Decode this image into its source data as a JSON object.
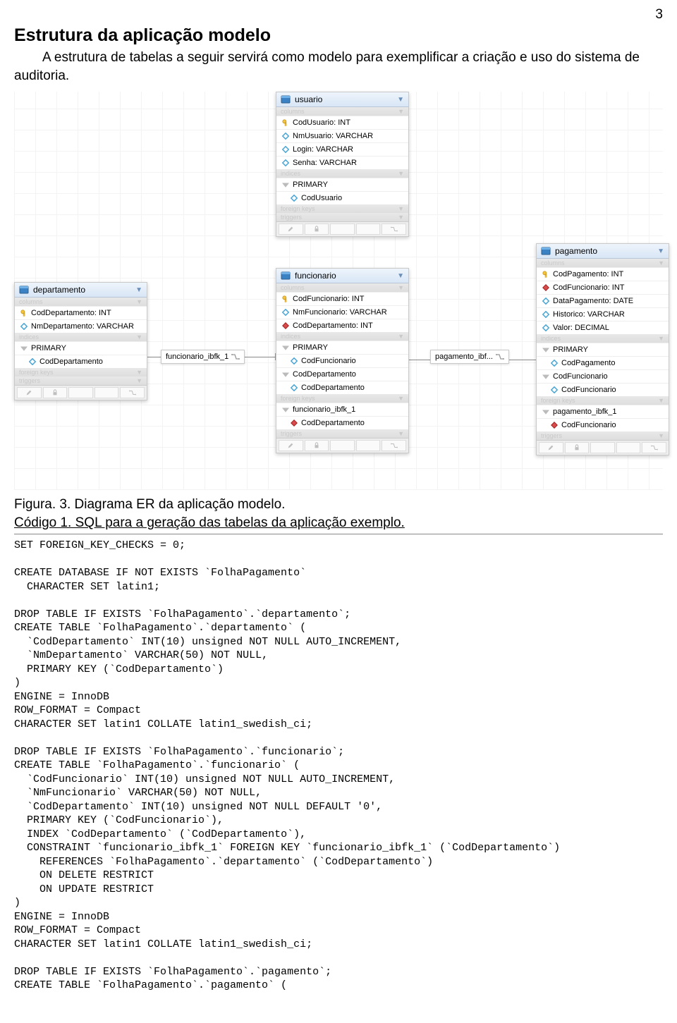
{
  "page_number": "3",
  "heading": "Estrutura da aplicação modelo",
  "intro": "A estrutura de tabelas a seguir servirá como modelo para exemplificar a criação e uso do sistema de auditoria.",
  "caption": "Figura. 3. Diagrama ER da aplicação modelo.",
  "code_title": "Código 1. SQL para a geração das tabelas da aplicação exemplo.",
  "diagram": {
    "tables": {
      "usuario": {
        "title": "usuario",
        "columns": [
          {
            "icon": "key",
            "text": "CodUsuario: INT"
          },
          {
            "icon": "dia",
            "text": "NmUsuario: VARCHAR"
          },
          {
            "icon": "dia",
            "text": "Login: VARCHAR"
          },
          {
            "icon": "dia",
            "text": "Senha: VARCHAR"
          }
        ],
        "indices": [
          {
            "text": "PRIMARY",
            "children": [
              {
                "icon": "dia",
                "text": "CodUsuario"
              }
            ]
          }
        ],
        "fk": [],
        "triggers": []
      },
      "departamento": {
        "title": "departamento",
        "columns": [
          {
            "icon": "key",
            "text": "CodDepartamento: INT"
          },
          {
            "icon": "dia",
            "text": "NmDepartamento: VARCHAR"
          }
        ],
        "indices": [
          {
            "text": "PRIMARY",
            "children": [
              {
                "icon": "dia",
                "text": "CodDepartamento"
              }
            ]
          }
        ],
        "fk": [],
        "triggers": []
      },
      "funcionario": {
        "title": "funcionario",
        "columns": [
          {
            "icon": "key",
            "text": "CodFuncionario: INT"
          },
          {
            "icon": "dia",
            "text": "NmFuncionario: VARCHAR"
          },
          {
            "icon": "red",
            "text": "CodDepartamento: INT"
          }
        ],
        "indices": [
          {
            "text": "PRIMARY",
            "children": [
              {
                "icon": "dia",
                "text": "CodFuncionario"
              }
            ]
          },
          {
            "text": "CodDepartamento",
            "children": [
              {
                "icon": "dia",
                "text": "CodDepartamento"
              }
            ]
          }
        ],
        "fk": [
          {
            "text": "funcionario_ibfk_1",
            "children": [
              {
                "icon": "red",
                "text": "CodDepartamento"
              }
            ]
          }
        ],
        "triggers": []
      },
      "pagamento": {
        "title": "pagamento",
        "columns": [
          {
            "icon": "key",
            "text": "CodPagamento: INT"
          },
          {
            "icon": "red",
            "text": "CodFuncionario: INT"
          },
          {
            "icon": "dia",
            "text": "DataPagamento: DATE"
          },
          {
            "icon": "dia",
            "text": "Historico: VARCHAR"
          },
          {
            "icon": "dia",
            "text": "Valor: DECIMAL"
          }
        ],
        "indices": [
          {
            "text": "PRIMARY",
            "children": [
              {
                "icon": "dia",
                "text": "CodPagamento"
              }
            ]
          },
          {
            "text": "CodFuncionario",
            "children": [
              {
                "icon": "dia",
                "text": "CodFuncionario"
              }
            ]
          }
        ],
        "fk": [
          {
            "text": "pagamento_ibfk_1",
            "children": [
              {
                "icon": "red",
                "text": "CodFuncionario"
              }
            ]
          }
        ],
        "triggers": []
      }
    },
    "labels": {
      "sec_columns": "columns",
      "sec_indices": "indices",
      "sec_fk": "foreign keys",
      "sec_trig": "triggers",
      "fk1": "funcionario_ibfk_1",
      "fk2": "pagamento_ibf..."
    }
  },
  "sql": "SET FOREIGN_KEY_CHECKS = 0;\n\nCREATE DATABASE IF NOT EXISTS `FolhaPagamento`\n  CHARACTER SET latin1;\n\nDROP TABLE IF EXISTS `FolhaPagamento`.`departamento`;\nCREATE TABLE `FolhaPagamento`.`departamento` (\n  `CodDepartamento` INT(10) unsigned NOT NULL AUTO_INCREMENT,\n  `NmDepartamento` VARCHAR(50) NOT NULL,\n  PRIMARY KEY (`CodDepartamento`)\n)\nENGINE = InnoDB\nROW_FORMAT = Compact\nCHARACTER SET latin1 COLLATE latin1_swedish_ci;\n\nDROP TABLE IF EXISTS `FolhaPagamento`.`funcionario`;\nCREATE TABLE `FolhaPagamento`.`funcionario` (\n  `CodFuncionario` INT(10) unsigned NOT NULL AUTO_INCREMENT,\n  `NmFuncionario` VARCHAR(50) NOT NULL,\n  `CodDepartamento` INT(10) unsigned NOT NULL DEFAULT '0',\n  PRIMARY KEY (`CodFuncionario`),\n  INDEX `CodDepartamento` (`CodDepartamento`),\n  CONSTRAINT `funcionario_ibfk_1` FOREIGN KEY `funcionario_ibfk_1` (`CodDepartamento`)\n    REFERENCES `FolhaPagamento`.`departamento` (`CodDepartamento`)\n    ON DELETE RESTRICT\n    ON UPDATE RESTRICT\n)\nENGINE = InnoDB\nROW_FORMAT = Compact\nCHARACTER SET latin1 COLLATE latin1_swedish_ci;\n\nDROP TABLE IF EXISTS `FolhaPagamento`.`pagamento`;\nCREATE TABLE `FolhaPagamento`.`pagamento` ("
}
